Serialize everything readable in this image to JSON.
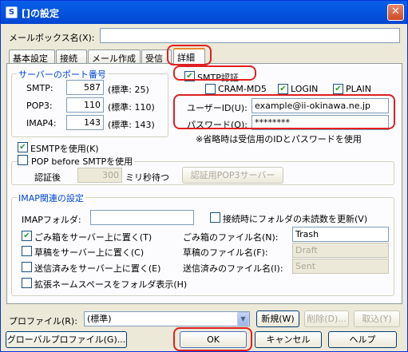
{
  "window": {
    "title": "[]の設定",
    "close": "✕",
    "icon": "S"
  },
  "mailbox": {
    "label": "メールボックス名(X):",
    "value": ""
  },
  "tabs": [
    "基本設定",
    "接続",
    "メール作成",
    "受信",
    "詳細"
  ],
  "ports": {
    "group_title": "サーバーのポート番号",
    "smtp": {
      "label": "SMTP:",
      "value": "587",
      "default": "(標準: 25)"
    },
    "pop3": {
      "label": "POP3:",
      "value": "110",
      "default": "(標準: 110)"
    },
    "imap4": {
      "label": "IMAP4:",
      "value": "143",
      "default": "(標準: 143)"
    }
  },
  "smtp_auth": {
    "label": "SMTP認証",
    "checked": true,
    "cram": {
      "label": "CRAM-MD5",
      "checked": false
    },
    "login": {
      "label": "LOGIN",
      "checked": true
    },
    "plain": {
      "label": "PLAIN",
      "checked": true
    },
    "user_label": "ユーザーID(U):",
    "user_value": "example@ii-okinawa.ne.jp",
    "pass_label": "パスワード(O):",
    "pass_value": "********",
    "note": "※省略時は受信用のIDとパスワードを使用"
  },
  "esmtp": {
    "label": "ESMTPを使用(K)",
    "checked": true
  },
  "pop_before": {
    "label": "POP before SMTPを使用",
    "checked": false,
    "wait_label": "認証後",
    "wait_value": "300",
    "wait_unit": "ミリ秒待つ",
    "server_button": "認証用POP3サーバー"
  },
  "imap": {
    "group_title": "IMAP関連の設定",
    "folder_label": "IMAPフォルダ:",
    "folder_value": "",
    "unread_label": "接続時にフォルダの未読数を更新(V)",
    "unread_checked": false,
    "trash": {
      "label": "ごみ箱をサーバー上に置く(T)",
      "checked": true,
      "file_label": "ごみ箱のファイル名(N):",
      "file_value": "Trash"
    },
    "draft": {
      "label": "草稿をサーバー上に置く(C)",
      "checked": false,
      "file_label": "草稿のファイル名(F):",
      "file_value": "Draft"
    },
    "sent": {
      "label": "送信済みをサーバー上に置く(E)",
      "checked": false,
      "file_label": "送信済みのファイル名(I):",
      "file_value": "Sent"
    },
    "namespace": {
      "label": "拡張ネームスペースをフォルダ表示(H)",
      "checked": false
    }
  },
  "profile": {
    "label": "プロファイル(R):",
    "value": "(標準)",
    "new": "新規(W)",
    "delete": "削除(D)...",
    "fetch": "取込(Y)"
  },
  "buttons": {
    "global": "グローバルプロファイル(G)...",
    "ok": "OK",
    "cancel": "キャンセル",
    "help": "ヘルプ"
  }
}
